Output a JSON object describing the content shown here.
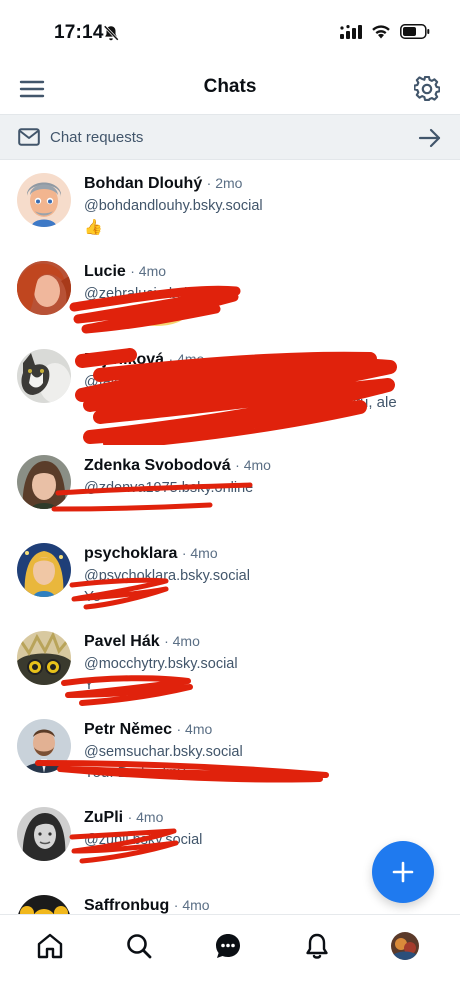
{
  "status_bar": {
    "time": "17:14",
    "icons": [
      "bell-off-icon",
      "cellular-icon",
      "wifi-icon",
      "battery-icon"
    ]
  },
  "header": {
    "title": "Chats",
    "menu_icon": "menu-icon",
    "settings_icon": "gear-icon"
  },
  "requests": {
    "label": "Chat requests",
    "icon": "mail-icon",
    "arrow": "arrow-right-icon"
  },
  "chats": [
    {
      "name": "Bohdan Dlouhý",
      "age": "· 2mo",
      "handle": "@bohdandlouhy.bsky.social",
      "preview": "👍"
    },
    {
      "name": "Lucie",
      "age": "· 4mo",
      "handle": "@zebralucie.bsky.social",
      "preview": ""
    },
    {
      "name": "Fajtrliková",
      "age": "· 4mo",
      "handle": "@fajtrlikova.bsky.social",
      "preview": "očtu, ale"
    },
    {
      "name": "Zdenka Svobodová",
      "age": "· 4mo",
      "handle": "@zdenva1975.bsky.online",
      "preview": ""
    },
    {
      "name": "psychoklara",
      "age": "· 4mo",
      "handle": "@psychoklara.bsky.social",
      "preview": "Yo"
    },
    {
      "name": "Pavel Hák",
      "age": "· 4mo",
      "handle": "@mocchytry.bsky.social",
      "preview": "Y"
    },
    {
      "name": "Petr Němec",
      "age": "· 4mo",
      "handle": "@semsuchar.bsky.social",
      "preview": "You: Do hodiny"
    },
    {
      "name": "ZuPli",
      "age": "· 4mo",
      "handle": "@zupli.bsky.social",
      "preview": ""
    },
    {
      "name": "Saffronbug",
      "age": "· 4mo",
      "handle": "",
      "preview": ""
    }
  ],
  "fab": {
    "icon": "plus-icon"
  },
  "bottom_nav": [
    "home-icon",
    "search-icon",
    "chat-icon",
    "bell-icon",
    "profile-avatar"
  ],
  "colors": {
    "accent": "#1f7aef",
    "redaction": "#e0220c",
    "muted_text": "#42566b"
  }
}
